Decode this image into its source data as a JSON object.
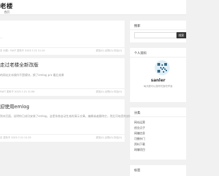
{
  "header": {
    "logo": "老楼",
    "nav_home": "首页"
  },
  "posts": [
    {
      "title": "",
      "excerpt": "...",
      "meta": "日 分类：FAST 发布于 2023-7-21 11:10",
      "views": "浏览(0) 点赞(0) 评论(0)"
    },
    {
      "title": "走过老楼全新改版",
      "excerpt": "的网站文本操作不是模块，换了emlog pro 最后成果",
      "meta": "FAST 发布于 2023-7-21 11:06",
      "views": "浏览(0) 点赞(0) 评论(0)"
    },
    {
      "title": "迎使用emlog",
      "excerpt": "到本页面，说明你已成功安装了emlog，这是系统自动生成的演示文章。编辑或者删除它，然后开始您的创作",
      "meta": "日 发布于 2023-7-21 11:23",
      "views": "浏览(0) 点赞(0) 评论(0)"
    }
  ],
  "sidebar": {
    "search": {
      "title": "搜索",
      "placeholder": "",
      "button": "搜索"
    },
    "profile": {
      "title": "个人资料",
      "name": "sanler",
      "desc": "每天都可以按时吃饭吃早饭"
    },
    "categories": {
      "title": "分类",
      "items": [
        "网站运营",
        "创业点子",
        "网赚信息",
        "可圈杂门",
        "资料下载",
        "网赚项目"
      ]
    },
    "tags": {
      "title": "标签"
    }
  }
}
